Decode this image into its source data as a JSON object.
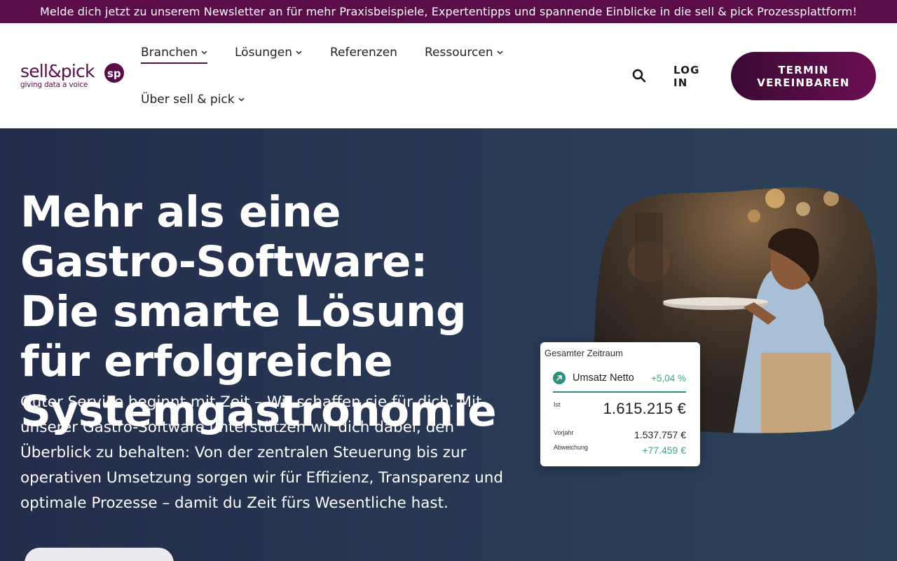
{
  "topbar": {
    "text": "Melde dich jetzt zu unserem Newsletter an für mehr Praxisbeispiele, Expertentipps und spannende Einblicke in die sell & pick Prozessplattform!"
  },
  "brand": {
    "name": "sell&pick",
    "tagline": "giving data a voice",
    "color": "#5a0d48"
  },
  "nav": {
    "items": [
      {
        "label": "Branchen",
        "has_dropdown": true,
        "active": true
      },
      {
        "label": "Lösungen",
        "has_dropdown": true
      },
      {
        "label": "Referenzen",
        "has_dropdown": false
      },
      {
        "label": "Ressourcen",
        "has_dropdown": true
      },
      {
        "label": "Über sell & pick",
        "has_dropdown": true
      }
    ],
    "search_icon": "search-icon",
    "login_label": "LOG IN",
    "cta_label": "TERMIN VEREINBAREN"
  },
  "hero": {
    "title": "Mehr als eine Gastro-Software: Die smarte Lösung für erfolgreiche Systemgastronomie",
    "text": "Guter Service beginnt mit Zeit – Wir schaffen sie für dich. Mit unserer Gastro-Software unterstützen wir dich dabei, den Überblick zu behalten: Von der zentralen Steuerung bis zur operativen Umsetzung sorgen wir für Effizienz, Transparenz und optimale Prozesse – damit du Zeit fürs Wesentliche hast."
  },
  "stats_card": {
    "title": "Gesamter Zeitraum",
    "metric_label": "Umsatz Netto",
    "metric_change": "+5,04 %",
    "ist_label": "Ist",
    "ist_value": "1.615.215 €",
    "vorjahr_label": "Vorjahr",
    "vorjahr_value": "1.537.757 €",
    "abweichung_label": "Abweichung",
    "abweichung_value": "+77.459 €"
  }
}
